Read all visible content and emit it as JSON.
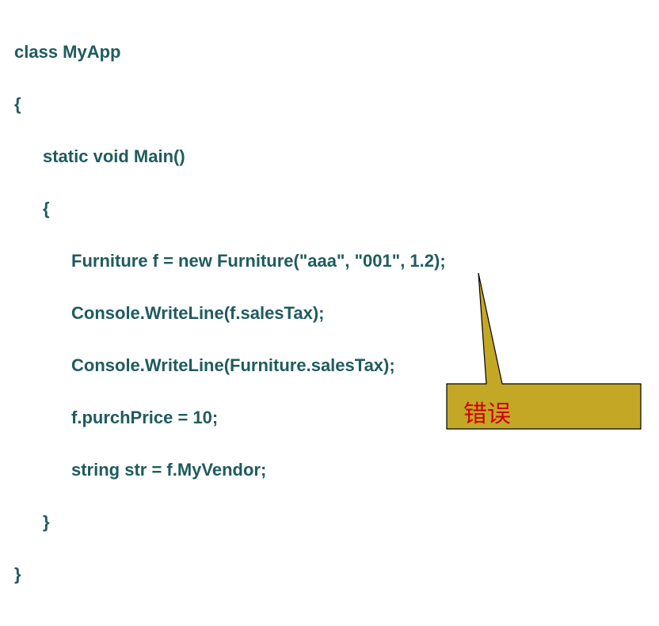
{
  "code": {
    "line1": "class MyApp",
    "line2": "{",
    "line3": "static void Main()",
    "line4": "{",
    "line5": "Furniture f = new Furniture(\"aaa\", \"001\", 1.2);",
    "line6": "Console.WriteLine(f.salesTax);",
    "line7": "Console.WriteLine(Furniture.salesTax);",
    "line8": "f.purchPrice = 10;",
    "line9": "string str = f.MyVendor;",
    "line10": "}",
    "line11": "}"
  },
  "callout": {
    "label": "错误",
    "fill": "#c3a826",
    "stroke": "#000000",
    "textColor": "#d20000"
  }
}
